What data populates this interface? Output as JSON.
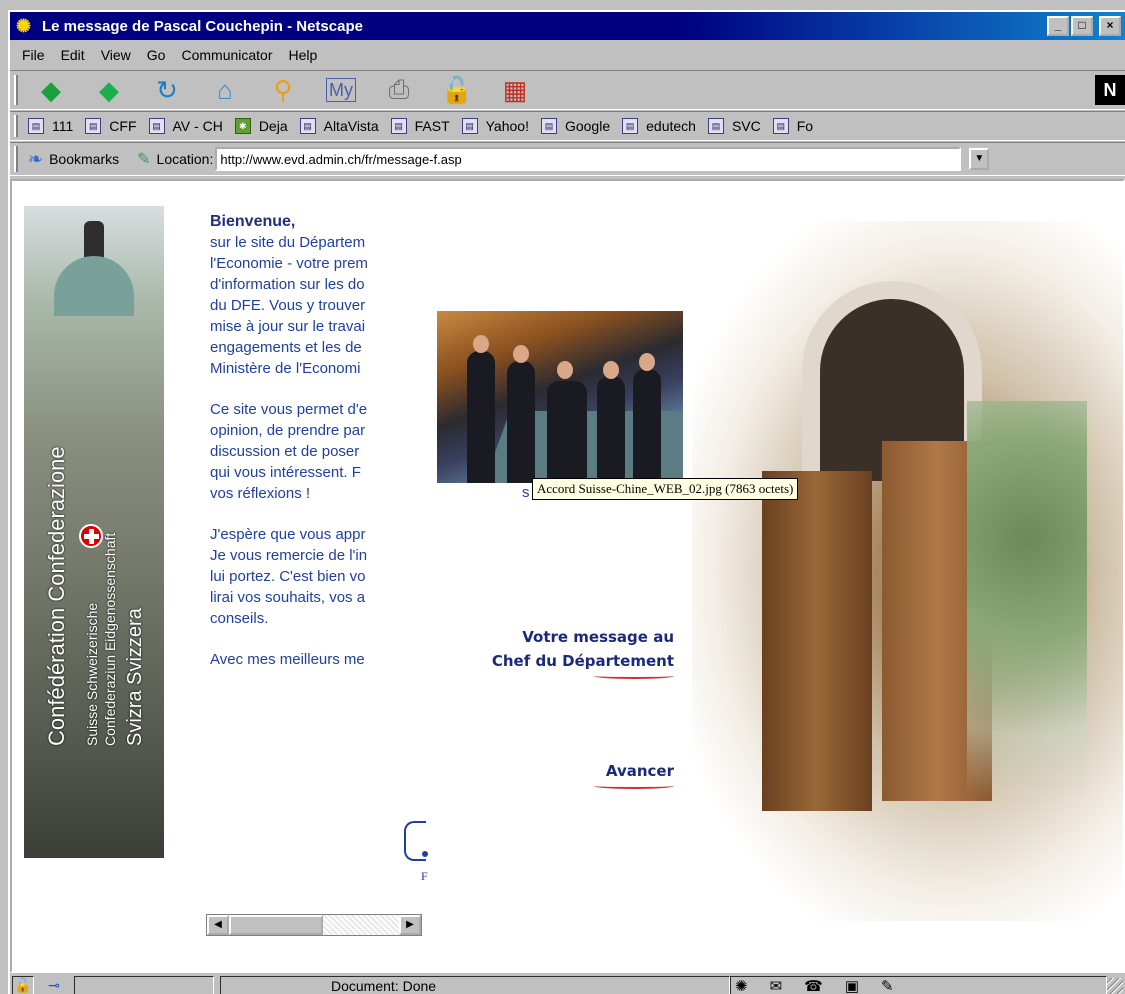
{
  "window": {
    "title": "Le message de Pascal Couchepin - Netscape",
    "controls": {
      "minimize": "_",
      "maximize": "□",
      "close": "×"
    }
  },
  "menu": [
    {
      "label": "File"
    },
    {
      "label": "Edit"
    },
    {
      "label": "View"
    },
    {
      "label": "Go"
    },
    {
      "label": "Communicator"
    },
    {
      "label": "Help"
    }
  ],
  "navigation_toolbar": {
    "buttons": [
      {
        "name": "back",
        "icon": "back-arrow-icon",
        "glyph": "◆"
      },
      {
        "name": "forward",
        "icon": "forward-arrow-icon",
        "glyph": "◆"
      },
      {
        "name": "reload",
        "icon": "reload-icon",
        "glyph": "↻"
      },
      {
        "name": "home",
        "icon": "home-icon",
        "glyph": "⌂"
      },
      {
        "name": "search",
        "icon": "search-icon",
        "glyph": "⚲"
      },
      {
        "name": "guide",
        "icon": "guide-icon",
        "glyph": "My"
      },
      {
        "name": "print",
        "icon": "print-icon",
        "glyph": "⎙"
      },
      {
        "name": "security",
        "icon": "security-lock-icon",
        "glyph": "🔓"
      },
      {
        "name": "stop",
        "icon": "stop-icon",
        "glyph": "▦"
      }
    ],
    "logo": "N"
  },
  "personal_toolbar": {
    "items": [
      {
        "label": "111"
      },
      {
        "label": "CFF"
      },
      {
        "label": "AV - CH"
      },
      {
        "label": "Deja"
      },
      {
        "label": "AltaVista"
      },
      {
        "label": "FAST"
      },
      {
        "label": "Yahoo!"
      },
      {
        "label": "Google"
      },
      {
        "label": "edutech"
      },
      {
        "label": "SVC"
      },
      {
        "label": "Fo"
      }
    ]
  },
  "location_toolbar": {
    "bookmarks_label": "Bookmarks",
    "location_label": "Location:",
    "url": "http://www.evd.admin.ch/fr/message-f.asp"
  },
  "page": {
    "banner": {
      "line1": "Confédération  Confederazione",
      "line2": "Suisse  Schweizerische",
      "line3": "Confederaziun  Eidgenossenschaft",
      "line4": "Svizra  Svizzera"
    },
    "welcome": {
      "heading": "Bienvenue,",
      "lines": [
        "sur le site du Départem",
        "l'Economie - votre prem",
        "d'information sur les do",
        "du DFE. Vous y trouver",
        "mise à jour sur le travai",
        "engagements et les de",
        "Ministère de l'Economi"
      ],
      "lines2": [
        "Ce site vous permet d'e",
        "opinion, de prendre par",
        "discussion et de poser",
        "qui vous intéressent. F",
        "vos réflexions !"
      ],
      "lines3": [
        "J'espère que vous appr",
        "Je vous remercie de l'in",
        "lui portez. C'est bien vo",
        "lirai vos souhaits, vos a",
        "conseils."
      ],
      "lines4": [
        "Avec mes meilleurs me"
      ]
    },
    "tooltip": "Accord Suisse-Chine_WEB_02.jpg (7863 octets)",
    "tooltip_prefix": "s",
    "link_message": {
      "line1": "Votre message au",
      "line2": "Chef du Département"
    },
    "link_avancer": "Avancer",
    "small_text": "F"
  },
  "statusbar": {
    "text": "Document: Done"
  }
}
